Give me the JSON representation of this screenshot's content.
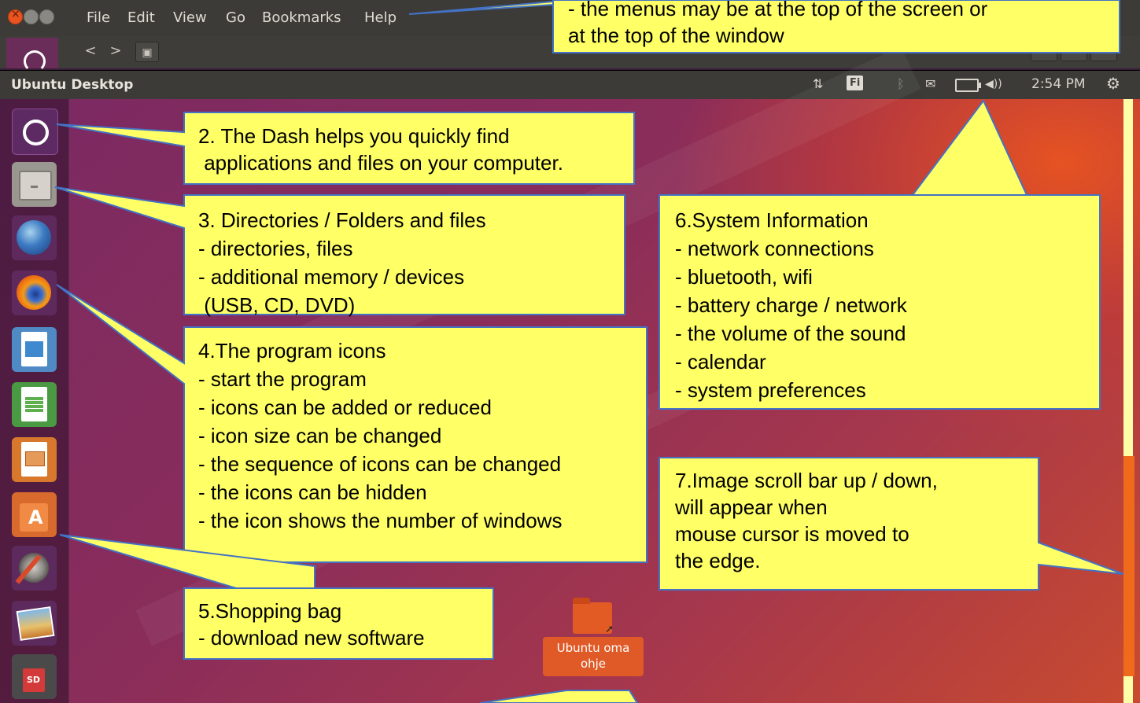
{
  "topwindow": {
    "menus": [
      "File",
      "Edit",
      "View",
      "Go",
      "Bookmarks",
      "Help"
    ],
    "nav_back": "<",
    "nav_forward": ">",
    "view_icon": "location-icon"
  },
  "panel": {
    "title": "Ubuntu Desktop",
    "network_icon": "⇅",
    "keyboard": "Fi",
    "bluetooth_icon": "bluetooth-icon",
    "mail_icon": "✉",
    "volume_icon": "◀))",
    "clock": "2:54 PM",
    "settings_icon": "gear-icon"
  },
  "launcher": {
    "items": [
      "dash",
      "files",
      "thunderbird",
      "firefox",
      "writer",
      "calc",
      "impress",
      "software-center",
      "settings",
      "photos",
      "sd-card"
    ]
  },
  "desktop_item": {
    "label_line1": "Ubuntu oma",
    "label_line2": "ohje"
  },
  "callouts": {
    "menu_note": {
      "line1": "- the menus may be at the top of the screen or",
      "line2": "at the top of the window"
    },
    "dash": {
      "line1": "2. The Dash helps you quickly find",
      "line2": " applications and files on your computer."
    },
    "folders": {
      "line1": "3. Directories / Folders and files",
      "line2": "- directories, files",
      "line3": "- additional memory / devices",
      "line4": " (USB, CD, DVD)"
    },
    "programs": {
      "line1": "4.The program icons",
      "line2": "- start the program",
      "line3": "- icons can be added or reduced",
      "line4": "- icon size can be changed",
      "line5": "- the sequence of icons can be changed",
      "line6": "- the icons can be hidden",
      "line7": "- the icon shows the number of windows"
    },
    "shopping": {
      "line1": "5.Shopping bag",
      "line2": "- download new software"
    },
    "system": {
      "line1": "6.System Information",
      "line2": "- network connections",
      "line3": "- bluetooth, wifi",
      "line4": "- battery charge / network",
      "line5": "- the volume of the sound",
      "line6": "- calendar",
      "line7": "- system preferences"
    },
    "scrollbar": {
      "line1": "7.Image scroll bar up / down,",
      "line2": "will appear when",
      "line3": "mouse cursor is moved to",
      "line4": "the edge."
    }
  },
  "colors": {
    "callout_fill": "#ffff66",
    "callout_border": "#4472c4",
    "ubuntu_orange": "#e95420",
    "panel_bg": "#3c3b37"
  }
}
